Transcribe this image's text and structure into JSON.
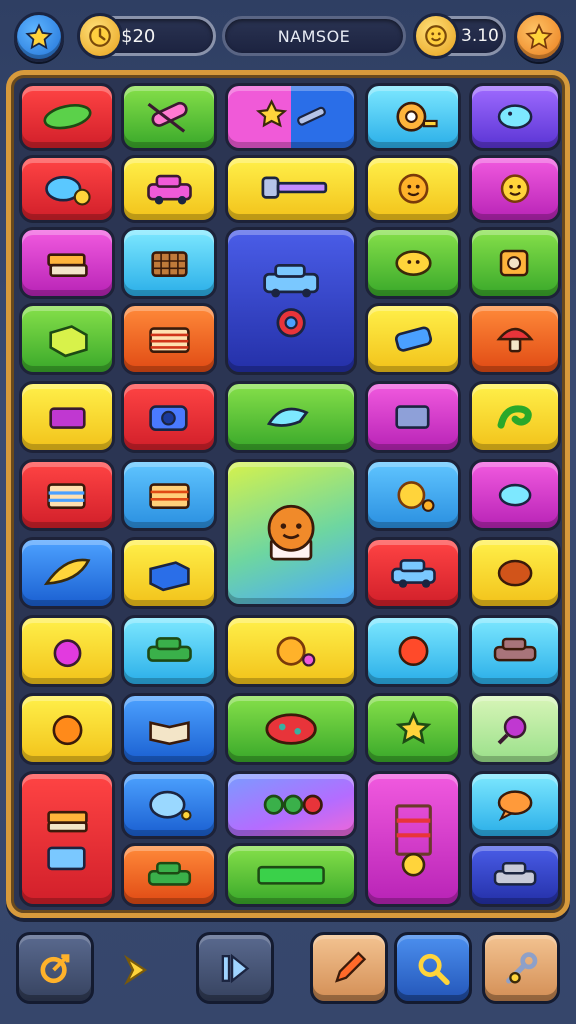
{
  "hud": {
    "coins": "$20",
    "player_name": "NAMSOE",
    "timer": "3.10"
  },
  "icons": {
    "left_button": "star-icon",
    "coins": "clock-coin-icon",
    "timer": "smiley-coin-icon",
    "right_button": "star-icon",
    "toolbar": [
      "target-arrow-icon",
      "play-arrow-icon",
      "skip-forward-icon",
      "pencil-icon",
      "magnifier-icon",
      "key-wrench-icon"
    ]
  },
  "colors": {
    "board_frame": "#d79a3c",
    "background": "#34456a",
    "accent_orange": "#e8791a",
    "accent_blue": "#1f6fd6"
  },
  "tiles": [
    "cucumber",
    "paint-roller-tools",
    "star-and-wrench",
    "tape-measure",
    "fish-bubble",
    "fish-with-coin",
    "pink-car",
    "hammer-ruler",
    "sun-face",
    "sun-face",
    "book-stack",
    "woven-basket",
    "blue-car",
    "smiling-leaf",
    "camera-box",
    "gift-box",
    "striped-books",
    "gear-wrench",
    "camera-pipe",
    "mushroom",
    "book",
    "blue-camera",
    "fish-rocket",
    "cash-register",
    "green-swirl",
    "picture-book",
    "striped-wallet",
    "orange-cat-cupcake",
    "sun-with-coin",
    "bubble-fish",
    "feather-pen",
    "blue-book",
    "blue-car",
    "chestnut",
    "pink-bell",
    "green-car",
    "sun-with-coin",
    "red-blob-face",
    "brown-car",
    "orange-fruit",
    "open-book",
    "ladybug-car",
    "green-star",
    "round-key",
    "book-stack",
    "bubble-cloud",
    "gears-and-wrench",
    "chair-ladder",
    "speech-bubble",
    "toolbox",
    "green-car",
    "green-bar",
    "smiling-sun",
    "grey-car"
  ]
}
